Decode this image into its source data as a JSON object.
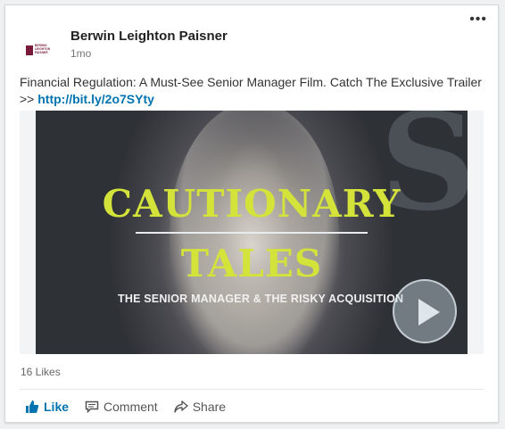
{
  "post": {
    "company": "Berwin Leighton Paisner",
    "logo_text": [
      "BERWIN",
      "LEIGHTON",
      "PAISNER"
    ],
    "time": "1mo",
    "text": "Financial Regulation: A Must-See Senior Manager Film. Catch The Exclusive Trailer >> ",
    "link": "http://bit.ly/2o7SYty",
    "more_label": "•••"
  },
  "video": {
    "title_line1": "CAUTIONARY",
    "title_line2": "TALES",
    "subtitle": "THE SENIOR MANAGER & THE RISKY ACQUISITION",
    "play_icon": "play-icon"
  },
  "social": {
    "likes": "16 Likes"
  },
  "actions": {
    "like": "Like",
    "comment": "Comment",
    "share": "Share"
  },
  "colors": {
    "accent": "#0073b1",
    "title": "#d4e33a",
    "brand": "#7a1a3a"
  }
}
